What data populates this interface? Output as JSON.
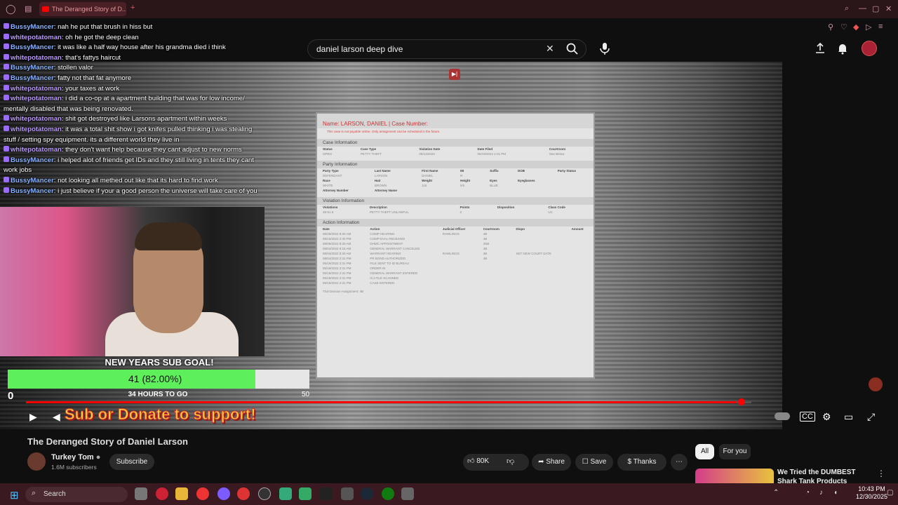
{
  "browser": {
    "tab_title": "The Deranged Story of D..."
  },
  "search": {
    "query": "daniel larson deep dive"
  },
  "chat": [
    {
      "user": "BussyMancer",
      "text": "nah he put that brush in hiss but"
    },
    {
      "user": "whitepotatoman",
      "text": "oh he got the deep clean"
    },
    {
      "user": "BussyMancer",
      "text": "it was like a half way house after his grandma died i think"
    },
    {
      "user": "whitepotatoman",
      "text": "that's fattys haircut"
    },
    {
      "user": "BussyMancer",
      "text": "stollen valor"
    },
    {
      "user": "BussyMancer",
      "text": "fatty not that fat anymore"
    },
    {
      "user": "whitepotatoman",
      "text": "your taxes at work"
    },
    {
      "user": "whitepotatoman",
      "text": "i did a co-op at a apartment building that was for low income/ mentally disabled that was being renovated."
    },
    {
      "user": "whitepotatoman",
      "text": "shit got destroyed like Larsons apartment within weeks"
    },
    {
      "user": "whitepotatoman",
      "text": "it was a total shit show i got knifes pulled thinking i was stealing stuff / setting spy equipment. its a different world they live in"
    },
    {
      "user": "whitepotatoman",
      "text": "they don't want help because they cant adjust to new norms"
    },
    {
      "user": "BussyMancer",
      "text": "i helped alot of friends get IDs and they still living in tents they cant work jobs"
    },
    {
      "user": "BussyMancer",
      "text": "not looking all methed out like that its hard to find work"
    },
    {
      "user": "BussyMancer",
      "text": "i just believe if your a good person the universe will take care of you"
    }
  ],
  "document": {
    "header": "Name: LARSON, DANIEL   |   Case Number:",
    "warning": "This case is not payable online. Only arraignment can be scheduled in the future.",
    "case_info": {
      "title": "Case Information",
      "headers": [
        "Status",
        "Case Type",
        "Violation Date",
        "Date Filed",
        "Courtroom"
      ],
      "row": [
        "OPEN",
        "PETTY THEFT",
        "05/13/2022",
        "05/19/2022 2:31 PM",
        "See Below"
      ]
    },
    "party_info": {
      "title": "Party Information",
      "headers": [
        "Party Type",
        "Last Name",
        "First Name",
        "MI",
        "Suffix",
        "DOB",
        "Party Status"
      ],
      "row": [
        "DEFENDANT",
        "LARSON",
        "DANIEL",
        "R",
        "",
        "",
        ""
      ],
      "headers2": [
        "Race",
        "Hair",
        "Weight",
        "Height",
        "Eyes",
        "Eyeglasses"
      ],
      "row2": [
        "WHITE",
        "BROWN",
        "115",
        "5'6",
        "BLUE",
        ""
      ],
      "attorney": [
        "Attorney Number",
        "Attorney Name"
      ]
    },
    "violation_info": {
      "title": "Violation Information",
      "headers": [
        "Violations",
        "Description",
        "Points",
        "Disposition",
        "Class Code"
      ],
      "row": [
        "38-51.6",
        "PETTY THEFT UNLAWFUL",
        "0",
        "",
        "UC"
      ]
    },
    "action_info": {
      "title": "Action Information",
      "headers": [
        "Date",
        "Action",
        "Judicial Officer",
        "Courtroom",
        "Dispo",
        "Amount"
      ],
      "rows": [
        [
          "08/29/2022 8:30 AM",
          "COMP HEARING",
          "RAWLINGS",
          "4B",
          "",
          ""
        ],
        [
          "08/19/2022 2:30 PM",
          "COMP EVAL RECEIVED",
          "",
          "4B",
          "",
          ""
        ],
        [
          "08/09/2022 8:30 AM",
          "DHMC APPOINTMENT",
          "",
          "3SB",
          "",
          ""
        ],
        [
          "08/04/2022 9:15 AM",
          "GENERAL WARRANT CANCELED",
          "",
          "4B",
          "",
          ""
        ],
        [
          "08/04/2022 8:30 AM",
          "WARRANT HEARING",
          "RAWLINGS",
          "4B",
          "SET NEW COURT DATE",
          ""
        ],
        [
          "08/04/2022 2:31 PM",
          "PR BOND AUTHORIZED",
          "",
          "4B",
          "",
          ""
        ],
        [
          "05/19/2022 2:31 PM",
          "FILE SENT TO ID BUREAU",
          "",
          "",
          "",
          ""
        ],
        [
          "05/19/2022 2:31 PM",
          "ORDER IN",
          "",
          "",
          "",
          ""
        ],
        [
          "05/19/2022 2:31 PM",
          "GENERAL WARRANT ENTERED",
          "",
          "",
          "",
          ""
        ],
        [
          "05/19/2022 2:31 PM",
          "ICJ FILE SCANNED",
          "",
          "",
          "",
          ""
        ],
        [
          "05/19/2022 2:31 PM",
          "CASE ENTERED",
          "",
          "",
          "",
          ""
        ]
      ]
    },
    "footer": "Trial Division Assignment: 4B"
  },
  "subgoal": {
    "title": "NEW YEARS SUB GOAL!",
    "label": "41 (82.00%)",
    "fraction": 0.82,
    "min": "0",
    "max": "50",
    "time_left": "34 HOURS TO GO"
  },
  "overlay": {
    "donate": "Sub or Donate to support!"
  },
  "player": {
    "progress": 0.98
  },
  "video": {
    "title": "The Deranged Story of Daniel Larson"
  },
  "channel": {
    "name": "Turkey Tom",
    "subscribers": "1.6M subscribers",
    "subscribe_label": "Subscribe"
  },
  "actions": {
    "likes": "80K",
    "share": "Share",
    "save": "Save",
    "thanks": "Thanks"
  },
  "sidebar": {
    "chips": [
      "All",
      "For you"
    ],
    "next_title": "We Tried the DUMBEST Shark Tank Products"
  },
  "taskbar": {
    "search_placeholder": "Search",
    "time": "10:43 PM",
    "date": "12/30/2025"
  },
  "colors": {
    "accent": "#ff0000",
    "goal_fill": "#5ef05a",
    "donate": "#ffd23a"
  }
}
